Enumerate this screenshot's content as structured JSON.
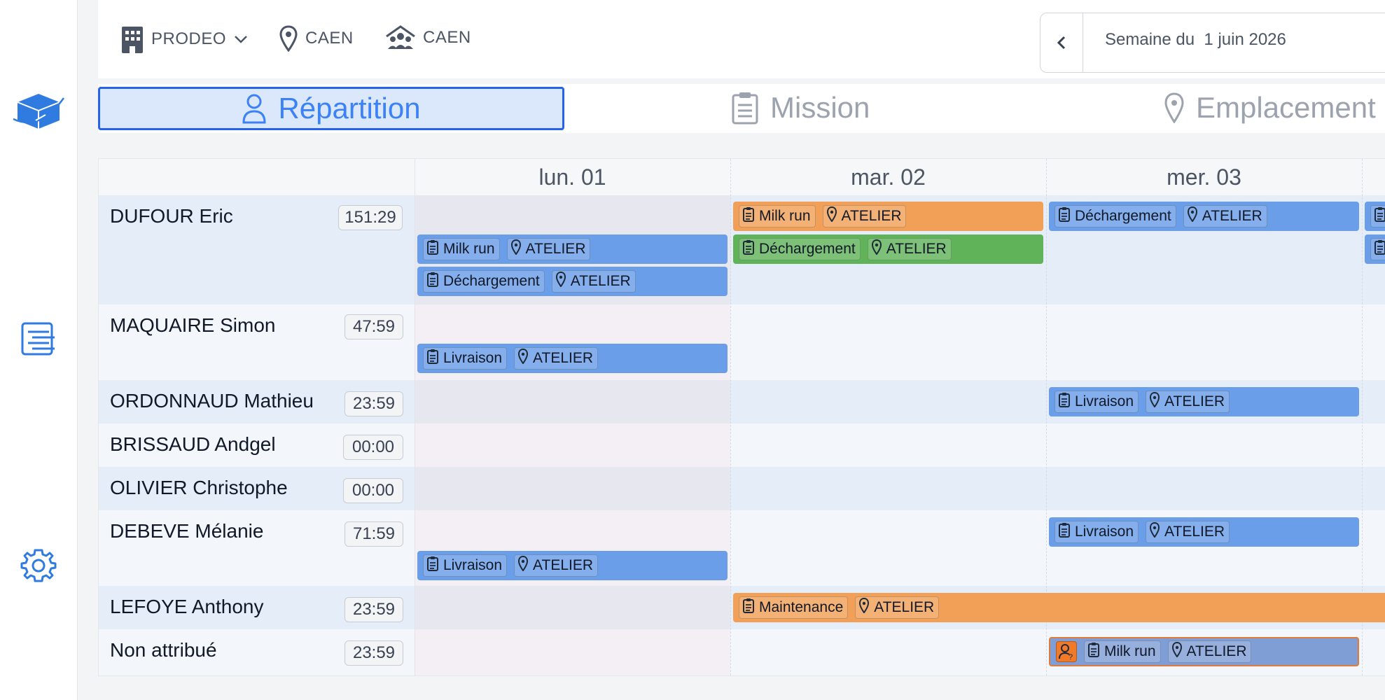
{
  "filters": {
    "company": "PRODEO",
    "site": "CAEN",
    "team": "CAEN"
  },
  "week": {
    "label": "Semaine du  1 juin 2026"
  },
  "tabs": [
    {
      "label": "Répartition",
      "active": true
    },
    {
      "label": "Mission",
      "active": false
    },
    {
      "label": "Emplacement",
      "active": false
    }
  ],
  "days": [
    "lun. 01",
    "mar. 02",
    "mer. 03"
  ],
  "rows": [
    {
      "name": "DUFOUR Eric",
      "hours": "151:29"
    },
    {
      "name": "MAQUAIRE Simon",
      "hours": "47:59"
    },
    {
      "name": "ORDONNAUD Mathieu",
      "hours": "23:59"
    },
    {
      "name": "BRISSAUD Andgel",
      "hours": "00:00"
    },
    {
      "name": "OLIVIER Christophe",
      "hours": "00:00"
    },
    {
      "name": "DEBEVE Mélanie",
      "hours": "71:59"
    },
    {
      "name": "LEFOYE Anthony",
      "hours": "23:59"
    },
    {
      "name": "Non attribué",
      "hours": "23:59"
    }
  ],
  "tasks": {
    "t1": {
      "mission": "Milk run",
      "location": "ATELIER"
    },
    "t2": {
      "mission": "Déchargement",
      "location": "ATELIER"
    },
    "t3": {
      "mission": "Milk run",
      "location": "ATELIER"
    },
    "t4": {
      "mission": "Déchargement",
      "location": "ATELIER"
    },
    "t5": {
      "mission": "Déchargement",
      "location": "ATELIER"
    },
    "t6": {
      "mission": "Livraison",
      "location": "ATELIER"
    },
    "t7": {
      "mission": "Livraison",
      "location": "ATELIER"
    },
    "t8": {
      "mission": "Livraison",
      "location": "ATELIER"
    },
    "t9": {
      "mission": "Livraison",
      "location": "ATELIER"
    },
    "t10": {
      "mission": "Maintenance",
      "location": "ATELIER"
    },
    "t11": {
      "mission": "Milk run",
      "location": "ATELIER"
    }
  },
  "colors": {
    "blue_task": "#6a9ee8",
    "orange_task": "#f2a058",
    "green_task": "#61b35a",
    "accent": "#3b82f6"
  }
}
